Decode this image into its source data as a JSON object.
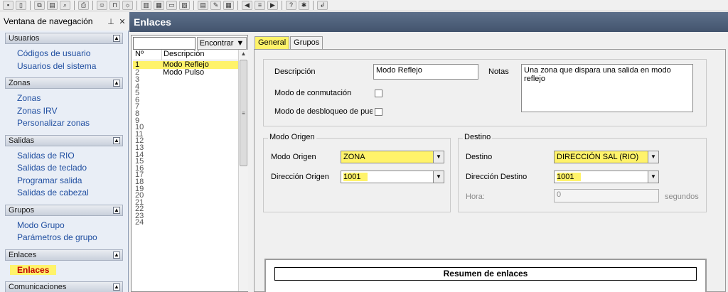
{
  "toolbar": {
    "buttons": [
      {
        "icon": "save-icon",
        "glyph": "▪"
      },
      {
        "icon": "attach-icon",
        "glyph": "▯"
      },
      {
        "icon": "copy-icon",
        "glyph": "⧉"
      },
      {
        "icon": "document-icon",
        "glyph": "▤"
      },
      {
        "icon": "zoom-icon",
        "glyph": "⌕"
      },
      {
        "icon": "print-icon",
        "glyph": "⎙"
      },
      {
        "icon": "people-icon",
        "glyph": "☺"
      },
      {
        "icon": "lock-icon",
        "glyph": "⊓"
      },
      {
        "icon": "user-gear-icon",
        "glyph": "☼"
      },
      {
        "icon": "doors-icon",
        "glyph": "▥"
      },
      {
        "icon": "grid-icon",
        "glyph": "▦"
      },
      {
        "icon": "window-icon",
        "glyph": "▭"
      },
      {
        "icon": "report-icon",
        "glyph": "▧"
      },
      {
        "icon": "sheet-icon",
        "glyph": "▤"
      },
      {
        "icon": "tools-icon",
        "glyph": "✎"
      },
      {
        "icon": "calendar-icon",
        "glyph": "▦"
      },
      {
        "icon": "back-icon",
        "glyph": "◀"
      },
      {
        "icon": "list-icon",
        "glyph": "≡"
      },
      {
        "icon": "forward-icon",
        "glyph": "▶"
      },
      {
        "icon": "help-icon",
        "glyph": "?"
      },
      {
        "icon": "info-icon",
        "glyph": "✱"
      },
      {
        "icon": "exit-icon",
        "glyph": "↲"
      }
    ]
  },
  "nav": {
    "title": "Ventana de navegación",
    "pin_glyph": "⊥",
    "close_glyph": "✕",
    "groups": [
      {
        "label": "Usuarios",
        "items": [
          "Códigos de usuario",
          "Usuarios del sistema"
        ]
      },
      {
        "label": "Zonas",
        "items": [
          "Zonas",
          "Zonas IRV",
          "Personalizar zonas"
        ]
      },
      {
        "label": "Salidas",
        "items": [
          "Salidas de RIO",
          "Salidas de teclado",
          "Programar salida",
          "Salidas de cabezal"
        ]
      },
      {
        "label": "Grupos",
        "items": [
          "Modo Grupo",
          "Parámetros de grupo"
        ]
      },
      {
        "label": "Enlaces",
        "items": [
          "Enlaces"
        ]
      },
      {
        "label": "Comunicaciones",
        "items": []
      }
    ],
    "active_item": "Enlaces"
  },
  "window": {
    "title": "Enlaces"
  },
  "list": {
    "search_value": "",
    "find_label": "Encontrar",
    "columns": {
      "no": "Nº",
      "desc": "Descripción"
    },
    "rows": [
      {
        "no": "1",
        "desc": "Modo Reflejo"
      },
      {
        "no": "2",
        "desc": "Modo Pulso"
      },
      {
        "no": "3",
        "desc": ""
      },
      {
        "no": "4",
        "desc": ""
      },
      {
        "no": "5",
        "desc": ""
      },
      {
        "no": "6",
        "desc": ""
      },
      {
        "no": "7",
        "desc": ""
      },
      {
        "no": "8",
        "desc": ""
      },
      {
        "no": "9",
        "desc": ""
      },
      {
        "no": "10",
        "desc": ""
      },
      {
        "no": "11",
        "desc": ""
      },
      {
        "no": "12",
        "desc": ""
      },
      {
        "no": "13",
        "desc": ""
      },
      {
        "no": "14",
        "desc": ""
      },
      {
        "no": "15",
        "desc": ""
      },
      {
        "no": "16",
        "desc": ""
      },
      {
        "no": "17",
        "desc": ""
      },
      {
        "no": "18",
        "desc": ""
      },
      {
        "no": "19",
        "desc": ""
      },
      {
        "no": "20",
        "desc": ""
      },
      {
        "no": "21",
        "desc": ""
      },
      {
        "no": "22",
        "desc": ""
      },
      {
        "no": "23",
        "desc": ""
      },
      {
        "no": "24",
        "desc": ""
      }
    ],
    "selected_index": 0
  },
  "details": {
    "tabs": [
      "General",
      "Grupos"
    ],
    "active_tab": "General",
    "descripcion_label": "Descripción",
    "descripcion_value": "Modo Reflejo",
    "notas_label": "Notas",
    "notas_value": "Una zona que dispara una salida en modo reflejo",
    "conmutacion_label": "Modo de conmutación",
    "desbloqueo_label": "Modo de desbloqueo de puei",
    "origen_group": "Modo Origen",
    "modo_origen_label": "Modo Origen",
    "modo_origen_value": "ZONA",
    "direccion_origen_label": "Dirección Origen",
    "direccion_origen_value": "1001",
    "destino_group": "Destino",
    "destino_label": "Destino",
    "destino_value": "DIRECCIÓN SAL (RIO)",
    "direccion_destino_label": "Dirección Destino",
    "direccion_destino_value": "1001",
    "hora_label": "Hora:",
    "hora_value": "0",
    "segundos_label": "segundos",
    "summary_title": "Resumen de enlaces"
  },
  "colors": {
    "highlight": "#fff36a",
    "title_bar": "#4d5f7a",
    "nav_link": "#1f4ea0",
    "nav_active": "#c00000"
  }
}
